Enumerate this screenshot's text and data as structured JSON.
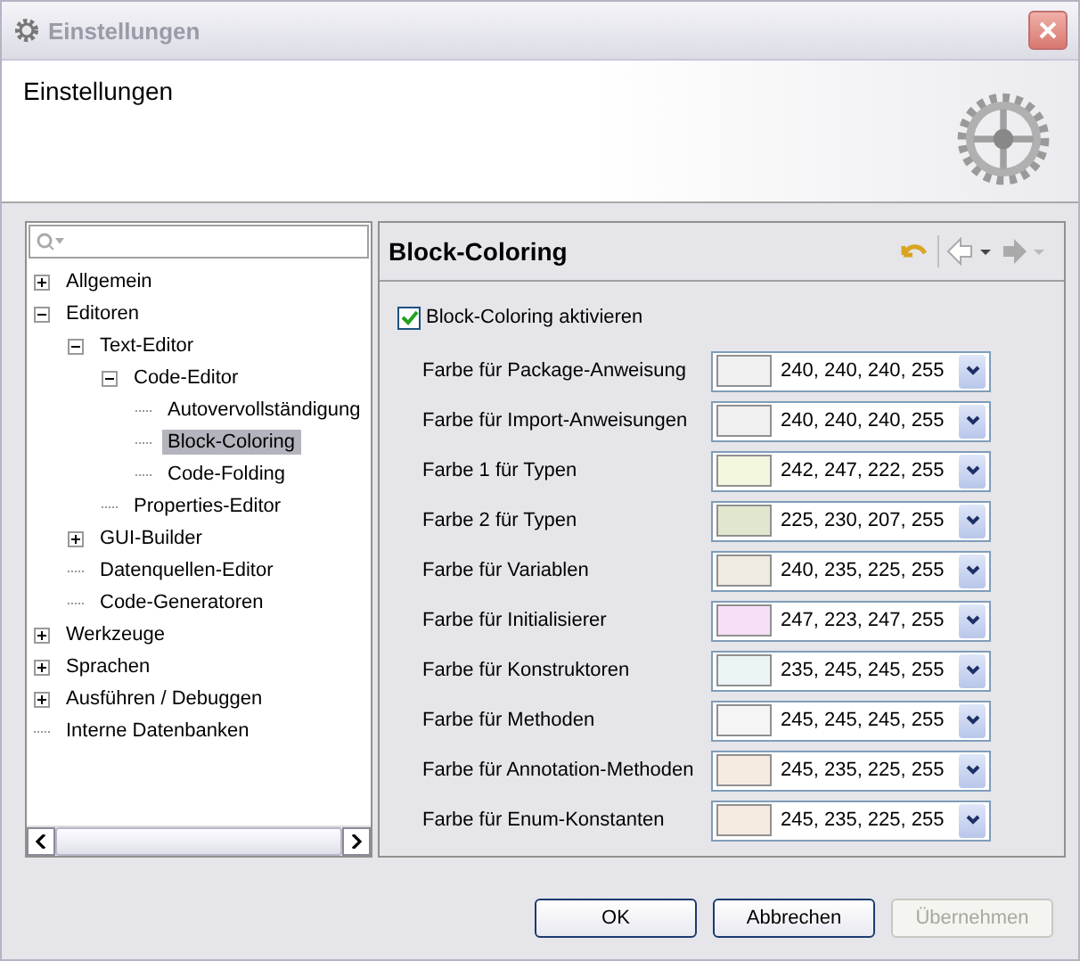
{
  "window": {
    "title": "Einstellungen"
  },
  "header": {
    "title": "Einstellungen"
  },
  "tree": {
    "items": [
      {
        "label": "Allgemein",
        "kind": "collapsed",
        "selected": false
      },
      {
        "label": "Editoren",
        "kind": "expanded",
        "selected": false,
        "children": [
          {
            "label": "Text-Editor",
            "kind": "expanded",
            "selected": false,
            "children": [
              {
                "label": "Code-Editor",
                "kind": "expanded",
                "selected": false,
                "children": [
                  {
                    "label": "Autovervollständigung",
                    "kind": "leaf",
                    "selected": false
                  },
                  {
                    "label": "Block-Coloring",
                    "kind": "leaf",
                    "selected": true
                  },
                  {
                    "label": "Code-Folding",
                    "kind": "leaf",
                    "selected": false
                  }
                ]
              },
              {
                "label": "Properties-Editor",
                "kind": "leaf",
                "selected": false
              }
            ]
          },
          {
            "label": "GUI-Builder",
            "kind": "collapsed",
            "selected": false
          },
          {
            "label": "Datenquellen-Editor",
            "kind": "leaf",
            "selected": false
          },
          {
            "label": "Code-Generatoren",
            "kind": "leaf",
            "selected": false
          }
        ]
      },
      {
        "label": "Werkzeuge",
        "kind": "collapsed",
        "selected": false
      },
      {
        "label": "Sprachen",
        "kind": "collapsed",
        "selected": false
      },
      {
        "label": "Ausführen / Debuggen",
        "kind": "collapsed",
        "selected": false
      },
      {
        "label": "Interne Datenbanken",
        "kind": "leaf",
        "selected": false
      }
    ]
  },
  "page": {
    "title": "Block-Coloring",
    "enable": {
      "label": "Block-Coloring aktivieren",
      "checked": true
    },
    "colors": [
      {
        "label": "Farbe für Package-Anweisung",
        "color": "#f0f0f0",
        "value": "240, 240, 240, 255"
      },
      {
        "label": "Farbe für Import-Anweisungen",
        "color": "#f0f0f0",
        "value": "240, 240, 240, 255"
      },
      {
        "label": "Farbe 1 für Typen",
        "color": "#f2f7de",
        "value": "242, 247, 222, 255"
      },
      {
        "label": "Farbe 2 für Typen",
        "color": "#e1e6cf",
        "value": "225, 230, 207, 255"
      },
      {
        "label": "Farbe für Variablen",
        "color": "#f0ebe1",
        "value": "240, 235, 225, 255"
      },
      {
        "label": "Farbe für Initialisierer",
        "color": "#f7dff7",
        "value": "247, 223, 247, 255"
      },
      {
        "label": "Farbe für Konstruktoren",
        "color": "#ebf5f5",
        "value": "235, 245, 245, 255"
      },
      {
        "label": "Farbe für Methoden",
        "color": "#f5f5f5",
        "value": "245, 245, 245, 255"
      },
      {
        "label": "Farbe für Annotation-Methoden",
        "color": "#f5ebe1",
        "value": "245, 235, 225, 255"
      },
      {
        "label": "Farbe für Enum-Konstanten",
        "color": "#f5ebe1",
        "value": "245, 235, 225, 255"
      }
    ]
  },
  "buttons": [
    {
      "label": "OK",
      "disabled": false
    },
    {
      "label": "Abbrechen",
      "disabled": false
    },
    {
      "label": "Übernehmen",
      "disabled": true
    }
  ]
}
